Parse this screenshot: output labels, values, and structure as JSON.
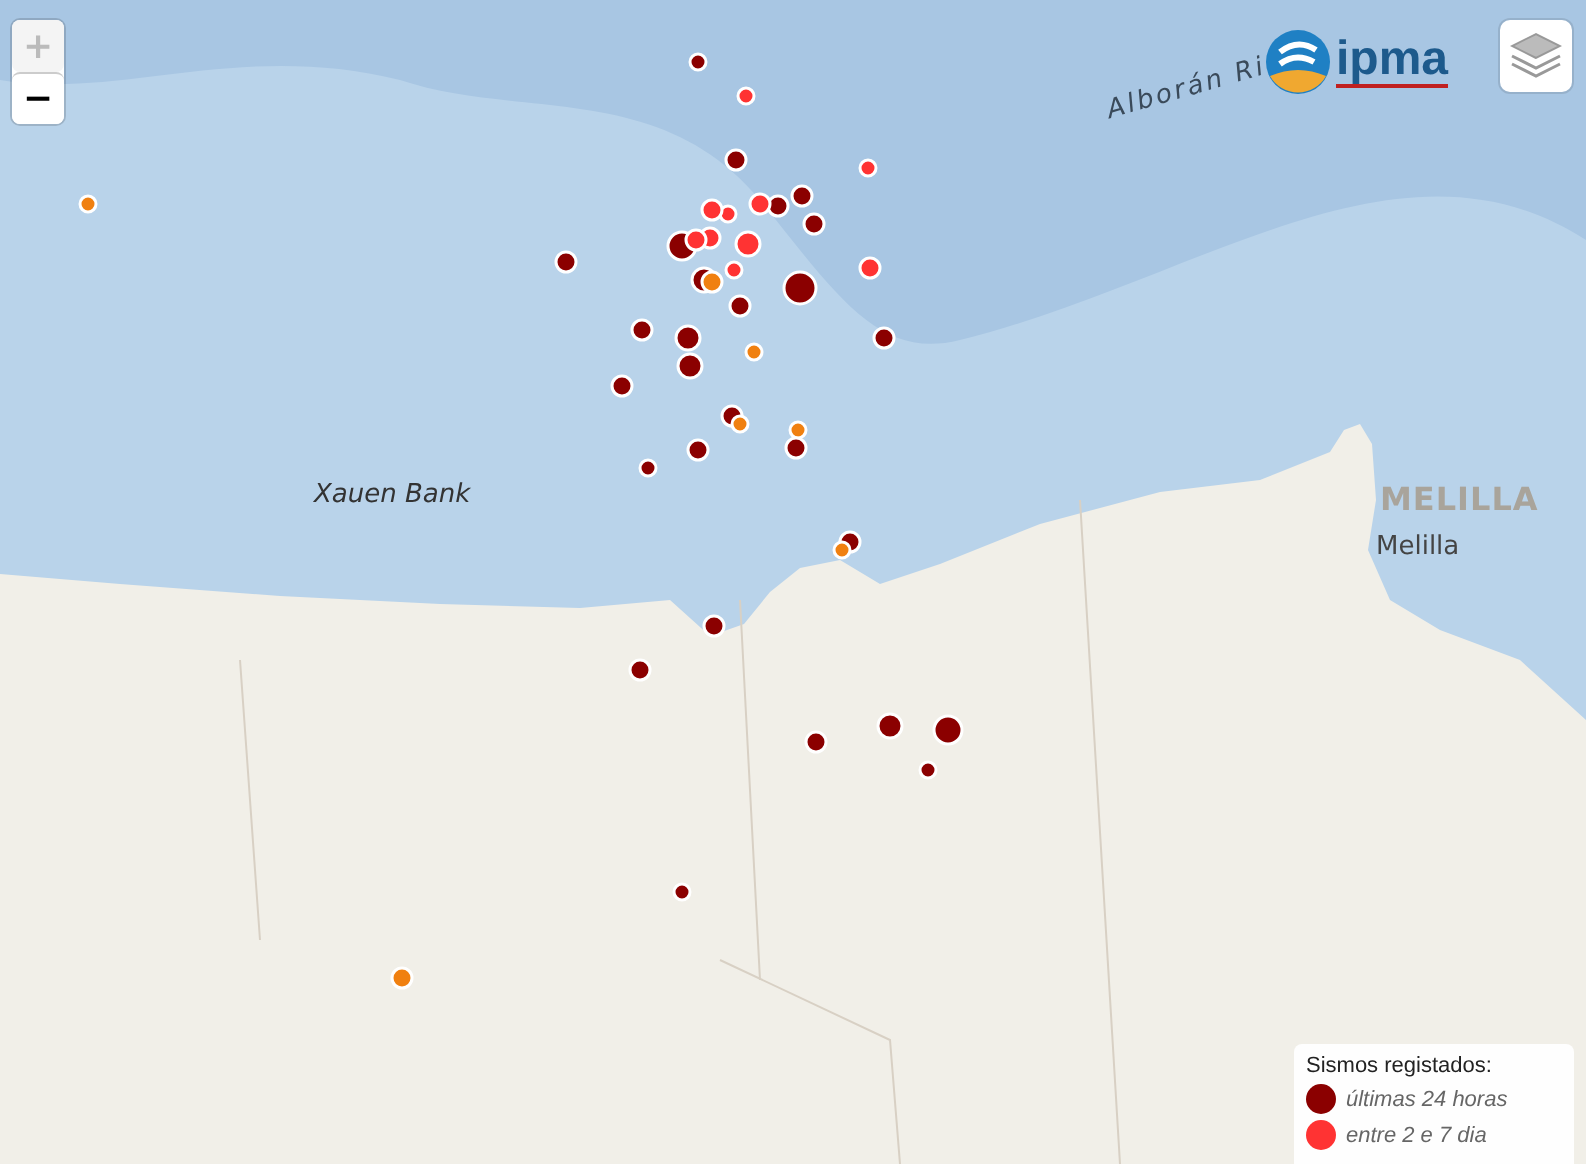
{
  "zoom_controls": {
    "zoom_in": "+",
    "zoom_out": "−",
    "zoom_in_disabled": true
  },
  "logo": {
    "text": "ipma"
  },
  "map_labels": [
    {
      "kind": "ridge",
      "text": "Alborán Ri"
    },
    {
      "kind": "bank",
      "text": "Xauen Bank"
    },
    {
      "kind": "region",
      "text": "MELILLA"
    },
    {
      "kind": "city",
      "text": "Melilla"
    }
  ],
  "markers": [
    {
      "kind": "day"
    },
    {
      "kind": "week"
    },
    {
      "kind": "day"
    },
    {
      "kind": "week"
    },
    {
      "kind": "older"
    },
    {
      "kind": "day"
    },
    {
      "kind": "day"
    },
    {
      "kind": "week"
    },
    {
      "kind": "week"
    },
    {
      "kind": "week"
    },
    {
      "kind": "day"
    },
    {
      "kind": "week"
    },
    {
      "kind": "week"
    },
    {
      "kind": "day"
    },
    {
      "kind": "week"
    },
    {
      "kind": "day"
    },
    {
      "kind": "week"
    },
    {
      "kind": "day"
    },
    {
      "kind": "week"
    },
    {
      "kind": "day"
    },
    {
      "kind": "older"
    },
    {
      "kind": "day"
    },
    {
      "kind": "day"
    },
    {
      "kind": "day"
    },
    {
      "kind": "day"
    },
    {
      "kind": "older"
    },
    {
      "kind": "day"
    },
    {
      "kind": "day"
    },
    {
      "kind": "day"
    },
    {
      "kind": "older"
    },
    {
      "kind": "older"
    },
    {
      "kind": "day"
    },
    {
      "kind": "day"
    },
    {
      "kind": "day"
    },
    {
      "kind": "day"
    },
    {
      "kind": "older"
    },
    {
      "kind": "day"
    },
    {
      "kind": "day"
    },
    {
      "kind": "day"
    },
    {
      "kind": "day"
    },
    {
      "kind": "day"
    },
    {
      "kind": "day"
    },
    {
      "kind": "day"
    },
    {
      "kind": "older"
    }
  ],
  "legend": {
    "title": "Sismos registados:",
    "items": [
      {
        "label": "últimas 24 horas",
        "color": "#8b0000"
      },
      {
        "label": "entre 2 e 7 dia",
        "color": "#ff3333"
      }
    ]
  }
}
